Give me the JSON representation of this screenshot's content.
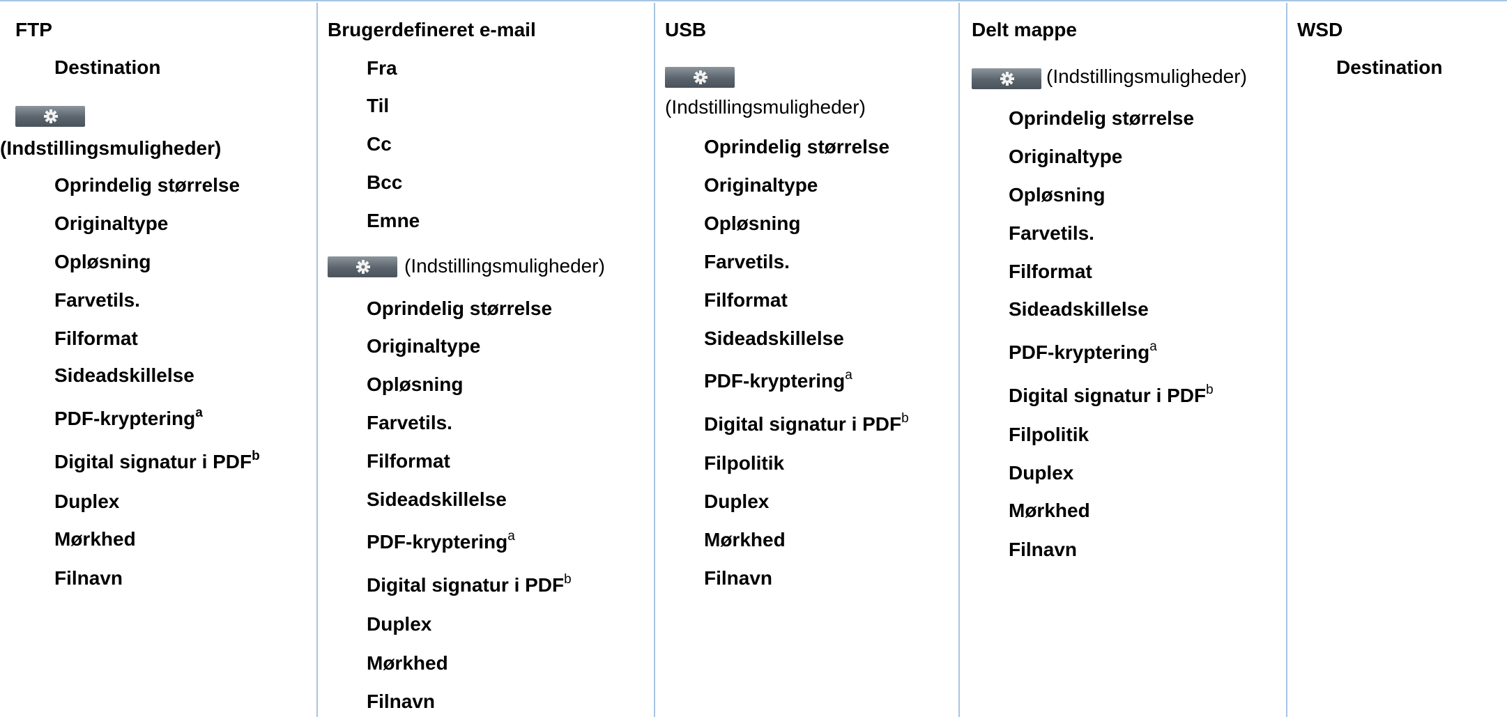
{
  "table": {
    "columns": [
      {
        "header": "FTP",
        "items": [
          "Destination"
        ],
        "options_label": "(Indstillingsmuligheder)",
        "options_items": [
          {
            "label": "Oprindelig størrelse"
          },
          {
            "label": "Originaltype"
          },
          {
            "label": "Opløsning"
          },
          {
            "label": "Farvetils."
          },
          {
            "label": "Filformat"
          },
          {
            "label": "Sideadskillelse"
          },
          {
            "label": "PDF-kryptering",
            "footnote": "a"
          },
          {
            "label": "Digital signatur i PDF",
            "footnote": "b"
          },
          {
            "label": "Duplex"
          },
          {
            "label": "Mørkhed"
          },
          {
            "label": "Filnavn"
          }
        ]
      },
      {
        "header": "Brugerdefineret e-mail",
        "items": [
          "Fra",
          "Til",
          "Cc",
          "Bcc",
          "Emne"
        ],
        "options_label": "(Indstillingsmuligheder)",
        "options_items": [
          {
            "label": "Oprindelig størrelse"
          },
          {
            "label": "Originaltype"
          },
          {
            "label": "Opløsning"
          },
          {
            "label": "Farvetils."
          },
          {
            "label": "Filformat"
          },
          {
            "label": "Sideadskillelse"
          },
          {
            "label": "PDF-kryptering",
            "footnote": "a"
          },
          {
            "label": "Digital signatur i PDF",
            "footnote": "b"
          },
          {
            "label": "Duplex"
          },
          {
            "label": "Mørkhed"
          },
          {
            "label": "Filnavn"
          }
        ]
      },
      {
        "header": "USB",
        "items": [],
        "options_label": "(Indstillingsmuligheder)",
        "options_items": [
          {
            "label": "Oprindelig størrelse"
          },
          {
            "label": "Originaltype"
          },
          {
            "label": "Opløsning"
          },
          {
            "label": "Farvetils."
          },
          {
            "label": "Filformat"
          },
          {
            "label": "Sideadskillelse"
          },
          {
            "label": "PDF-kryptering",
            "footnote": "a"
          },
          {
            "label": "Digital signatur i PDF",
            "footnote": "b"
          },
          {
            "label": "Filpolitik"
          },
          {
            "label": "Duplex"
          },
          {
            "label": "Mørkhed"
          },
          {
            "label": "Filnavn"
          }
        ]
      },
      {
        "header": "Delt mappe",
        "items": [],
        "options_label": "(Indstillingsmuligheder)",
        "options_items": [
          {
            "label": "Oprindelig størrelse"
          },
          {
            "label": "Originaltype"
          },
          {
            "label": "Opløsning"
          },
          {
            "label": "Farvetils."
          },
          {
            "label": "Filformat"
          },
          {
            "label": "Sideadskillelse"
          },
          {
            "label": "PDF-kryptering",
            "footnote": "a"
          },
          {
            "label": "Digital signatur i PDF",
            "footnote": "b"
          },
          {
            "label": "Filpolitik"
          },
          {
            "label": "Duplex"
          },
          {
            "label": "Mørkhed"
          },
          {
            "label": "Filnavn"
          }
        ]
      },
      {
        "header": "WSD",
        "items": [
          "Destination"
        ]
      }
    ]
  },
  "colors": {
    "border": "#a7c5e3",
    "settings_button": "#5b646c"
  },
  "icons": {
    "settings_button": "gear-icon"
  }
}
